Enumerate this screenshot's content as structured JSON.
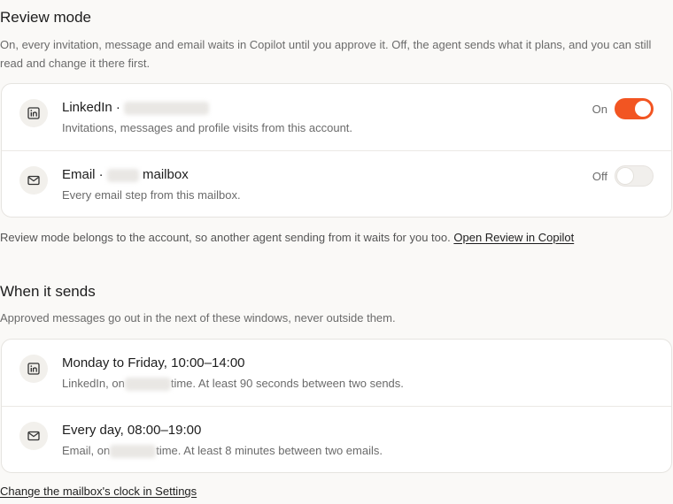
{
  "review": {
    "title": "Review mode",
    "description": "On, every invitation, message and email waits in Copilot until you approve it. Off, the agent sends what it plans, and you can still read and change it there first.",
    "rows": [
      {
        "icon": "linkedin-icon",
        "title_prefix": "LinkedIn · ",
        "title_suffix": "",
        "subtitle": "Invitations, messages and profile visits from this account.",
        "state_label": "On",
        "enabled": true
      },
      {
        "icon": "mail-icon",
        "title_prefix": "Email · ",
        "title_suffix": "mailbox",
        "subtitle": "Every email step from this mailbox.",
        "state_label": "Off",
        "enabled": false
      }
    ],
    "note": "Review mode belongs to the account, so another agent sending from it waits for you too.",
    "note_link": "Open Review in Copilot"
  },
  "sending": {
    "title": "When it sends",
    "description": "Approved messages go out in the next of these windows, never outside them.",
    "rows": [
      {
        "icon": "linkedin-icon",
        "title": "Monday to Friday, 10:00–14:00",
        "sub_prefix": "LinkedIn, on",
        "sub_suffix": "time. At least 90 seconds between two sends."
      },
      {
        "icon": "mail-icon",
        "title": "Every day, 08:00–19:00",
        "sub_prefix": "Email, on",
        "sub_suffix": "time. At least 8 minutes between two emails."
      }
    ],
    "footer_link": "Change the mailbox's clock in Settings"
  }
}
